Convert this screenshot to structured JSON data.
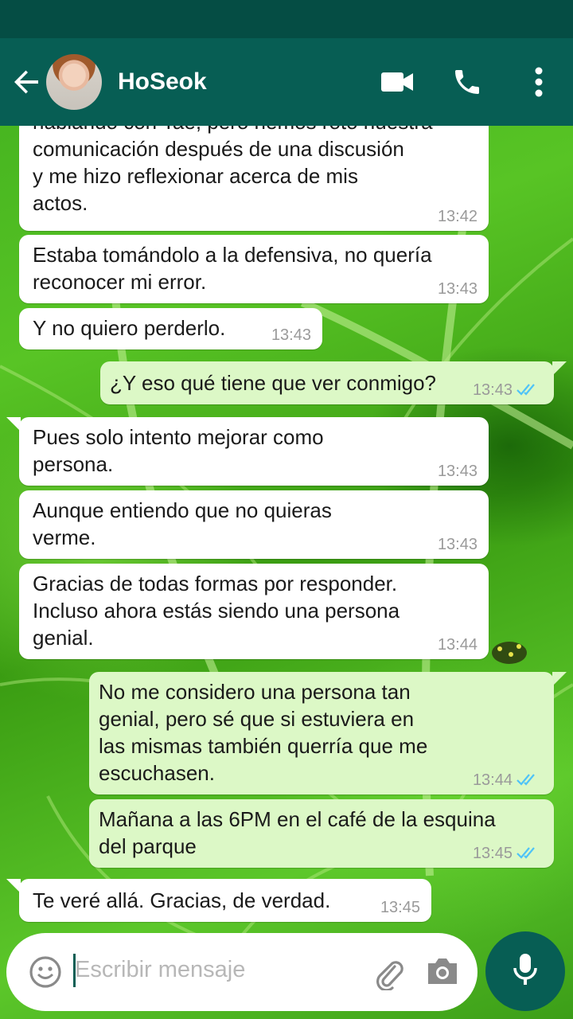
{
  "header": {
    "contact_name": "HoSeok",
    "colors": {
      "app_bar": "#075e54",
      "status_bar": "#054d44"
    },
    "icons": [
      "back-arrow-icon",
      "video-call-icon",
      "phone-icon",
      "more-vert-icon"
    ]
  },
  "messages": [
    {
      "id": "m1",
      "direction": "in",
      "text": "hablando con Tae, pero hemos roto nuestra\ncomunicación después de una discusión\ny me hizo reflexionar acerca de mis\nactos.",
      "time": "13:42"
    },
    {
      "id": "m2",
      "direction": "in",
      "text": "Estaba tomándolo a la defensiva, no quería\nreconocer mi error.",
      "time": "13:43"
    },
    {
      "id": "m3",
      "direction": "in",
      "text": "Y no quiero perderlo.",
      "time": "13:43"
    },
    {
      "id": "m4",
      "direction": "out",
      "text": "¿Y eso qué tiene que ver conmigo?",
      "time": "13:43",
      "status": "read"
    },
    {
      "id": "m5",
      "direction": "in",
      "text": "Pues solo intento mejorar como\npersona.",
      "time": "13:43"
    },
    {
      "id": "m6",
      "direction": "in",
      "text": "Aunque entiendo que no quieras\nverme.",
      "time": "13:43"
    },
    {
      "id": "m7",
      "direction": "in",
      "text": "Gracias de todas formas por responder.\nIncluso ahora estás siendo una persona\ngenial.",
      "time": "13:44"
    },
    {
      "id": "m8",
      "direction": "out",
      "text": "No me considero una persona tan\ngenial, pero sé que si estuviera en\nlas mismas también querría que me\nescuchasen.",
      "time": "13:44",
      "status": "read"
    },
    {
      "id": "m9",
      "direction": "out",
      "text": "Mañana a las 6PM en el café de la esquina\ndel parque",
      "time": "13:45",
      "status": "read"
    },
    {
      "id": "m10",
      "direction": "in",
      "text": "Te veré allá. Gracias, de verdad.",
      "time": "13:45"
    }
  ],
  "composer": {
    "placeholder": "Escribir mensaje",
    "icons": [
      "emoji-icon",
      "attach-icon",
      "camera-icon",
      "mic-icon"
    ]
  },
  "colors": {
    "incoming_bubble": "#ffffff",
    "outgoing_bubble": "#dcf8c6",
    "read_ticks": "#4fc3f7"
  }
}
